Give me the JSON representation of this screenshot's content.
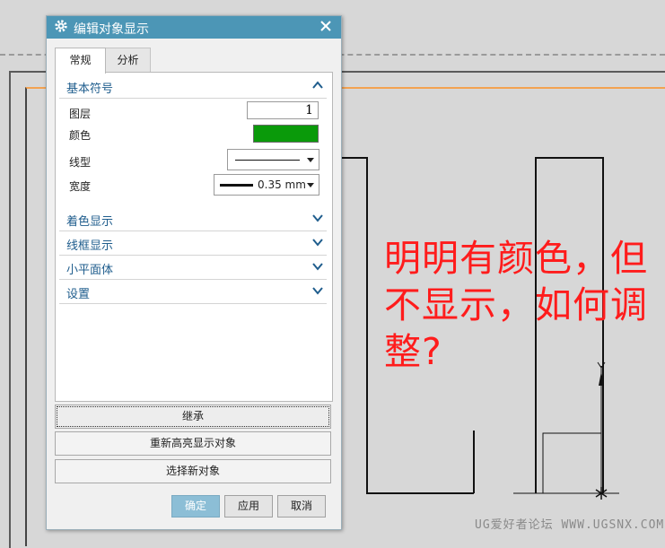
{
  "dialog": {
    "title": "编辑对象显示",
    "tabs": [
      {
        "label": "常规"
      },
      {
        "label": "分析"
      }
    ],
    "basic_symbols": {
      "header": "基本符号",
      "layer_label": "图层",
      "layer_value": "1",
      "color_label": "颜色",
      "color_value": "#0a9a0a",
      "linetype_label": "线型",
      "width_label": "宽度",
      "width_value": "0.35 mm"
    },
    "sections": [
      {
        "label": "着色显示"
      },
      {
        "label": "线框显示"
      },
      {
        "label": "小平面体"
      },
      {
        "label": "设置"
      }
    ],
    "buttons": {
      "inherit": "继承",
      "rehighlight": "重新高亮显示对象",
      "select_new": "选择新对象",
      "ok": "确定",
      "apply": "应用",
      "cancel": "取消"
    }
  },
  "annotation": "明明有颜色，但不显示，如何调整?",
  "watermark": "UG爱好者论坛 WWW.UGSNX.COM",
  "colors": {
    "titlebar": "#4c96b6",
    "section_text": "#1f5d8d",
    "annotation": "#ff1c1c",
    "frame_orange": "#f3a251"
  }
}
